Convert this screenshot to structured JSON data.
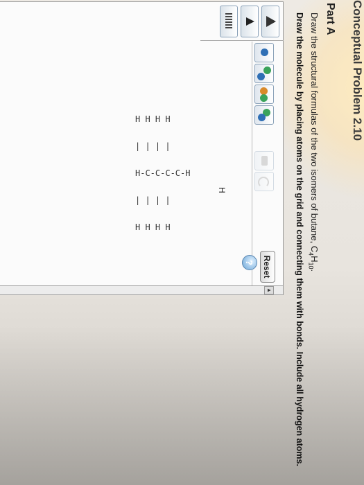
{
  "header": {
    "title": "Conceptual Problem 2.10"
  },
  "part": {
    "label": "Part A"
  },
  "instructions": {
    "line1_prefix": "Draw the structural formulas of the two isomers of butane, ",
    "formula_c": "C",
    "formula_c_sub": "4",
    "formula_h": "H",
    "formula_h_sub": "10",
    "formula_end": ".",
    "line2": "Draw the molecule by placing atoms on the grid and connecting them with bonds. Include all hydrogen atoms."
  },
  "editor": {
    "reset_label": "Reset",
    "help_label": "?",
    "canvas_label": "H",
    "molecule_lines": [
      "H H H H",
      "| | | |",
      "H-C-C-C-C-H",
      "| | | |",
      "H H H H"
    ],
    "scroll_arrow": "▲"
  },
  "tools": [
    "single-bond-tool",
    "double-bond-tool",
    "triple-bond-tool",
    "ring-tool",
    "eraser-tool",
    "undo-tool",
    "redo-tool"
  ],
  "colors": {
    "accent": "#4f86b8",
    "atom_green": "#3aa35a",
    "atom_blue": "#2f6fb5",
    "atom_orange": "#d98a2a"
  }
}
